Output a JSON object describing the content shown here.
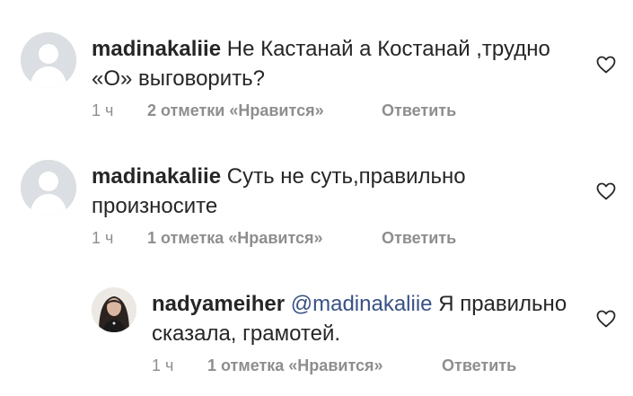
{
  "comments": [
    {
      "username": "madinakaliie",
      "mention": "",
      "text": "Не Кастанай а Костанай ,трудно «О» выговорить?",
      "time": "1 ч",
      "likes": "2 отметки «Нравится»",
      "reply": "Ответить",
      "avatar": "default-avatar"
    },
    {
      "username": "madinakaliie",
      "mention": "",
      "text": "Суть не суть,правильно произносите",
      "time": "1 ч",
      "likes": "1 отметка «Нравится»",
      "reply": "Ответить",
      "avatar": "default-avatar"
    },
    {
      "username": "nadyameiher",
      "mention": "@madinakaliie",
      "text": "Я правильно сказала, грамотей.",
      "time": "1 ч",
      "likes": "1 отметка «Нравится»",
      "reply": "Ответить",
      "avatar": "profile-photo"
    }
  ],
  "colors": {
    "text": "#262626",
    "meta": "#8e8e8e",
    "mention": "#385185",
    "avatar_placeholder": "#dbdee2"
  },
  "icons": {
    "like": "heart-outline-icon"
  }
}
